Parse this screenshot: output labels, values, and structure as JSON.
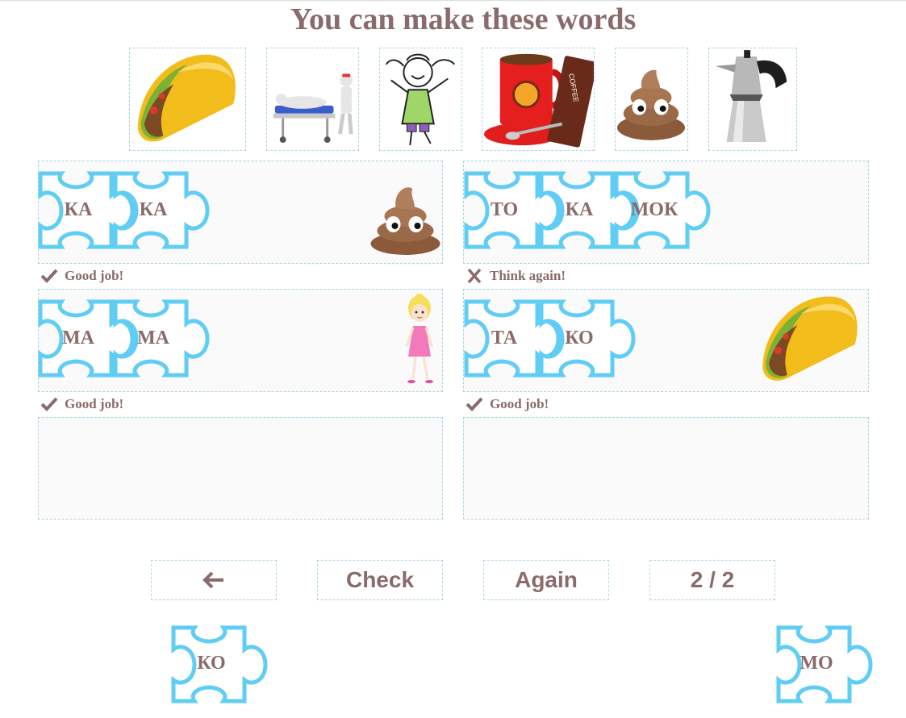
{
  "title": "You can make these words",
  "pictures": [
    {
      "name": "taco-picture"
    },
    {
      "name": "hospital-bed-picture"
    },
    {
      "name": "girl-drawing-picture"
    },
    {
      "name": "coffee-mug-picture"
    },
    {
      "name": "poop-emoji-picture"
    },
    {
      "name": "moka-pot-picture"
    }
  ],
  "slots": [
    {
      "syllables": [
        "КА",
        "КА"
      ],
      "thumbnail": "poop-emoji",
      "feedback": "Good job!",
      "status": "correct"
    },
    {
      "syllables": [
        "ТО",
        "КА",
        "МОК"
      ],
      "thumbnail": "",
      "feedback": "Think again!",
      "status": "wrong"
    },
    {
      "syllables": [
        "МА",
        "МА"
      ],
      "thumbnail": "mom-doll",
      "feedback": "Good job!",
      "status": "correct"
    },
    {
      "syllables": [
        "ТА",
        "КО"
      ],
      "thumbnail": "taco",
      "feedback": "Good job!",
      "status": "correct"
    },
    {
      "syllables": [],
      "thumbnail": "",
      "feedback": "",
      "status": "empty"
    },
    {
      "syllables": [],
      "thumbnail": "",
      "feedback": "",
      "status": "empty"
    }
  ],
  "buttons": {
    "back_icon": "arrow-left-icon",
    "check_label": "Check",
    "again_label": "Again",
    "page_indicator": "2 / 2"
  },
  "loose_pieces": [
    {
      "syllable": "КО"
    },
    {
      "syllable": "МО"
    }
  ],
  "colors": {
    "text": "#8a6a6a",
    "puzzle_outline": "#5fcdf5",
    "dashed_border": "#a9d6e5"
  }
}
